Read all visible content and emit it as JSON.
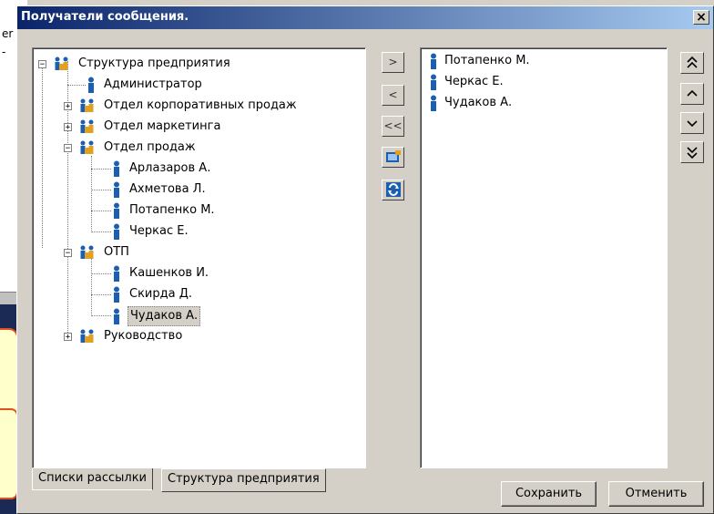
{
  "background": {
    "text_lines": [
      "er",
      "-"
    ]
  },
  "dialog": {
    "title": "Получатели сообщения.",
    "close_glyph": "×"
  },
  "tree": {
    "root": "Структура предприятия",
    "items": [
      {
        "label": "Структура предприятия",
        "type": "group",
        "level": 0,
        "expander": "−"
      },
      {
        "label": "Администратор",
        "type": "person",
        "level": 1,
        "expander": ""
      },
      {
        "label": "Отдел корпоративных продаж",
        "type": "group",
        "level": 1,
        "expander": "+"
      },
      {
        "label": "Отдел маркетинга",
        "type": "group",
        "level": 1,
        "expander": "+"
      },
      {
        "label": "Отдел продаж",
        "type": "group",
        "level": 1,
        "expander": "−"
      },
      {
        "label": "Арлазаров А.",
        "type": "person",
        "level": 2,
        "expander": ""
      },
      {
        "label": "Ахметова Л.",
        "type": "person",
        "level": 2,
        "expander": ""
      },
      {
        "label": "Потапенко М.",
        "type": "person",
        "level": 2,
        "expander": ""
      },
      {
        "label": "Черкас Е.",
        "type": "person",
        "level": 2,
        "expander": ""
      },
      {
        "label": "ОТП",
        "type": "group",
        "level": 1,
        "expander": "−"
      },
      {
        "label": "Кашенков И.",
        "type": "person",
        "level": 2,
        "expander": ""
      },
      {
        "label": "Скирда Д.",
        "type": "person",
        "level": 2,
        "expander": ""
      },
      {
        "label": "Чудаков А.",
        "type": "person",
        "level": 2,
        "expander": "",
        "selected": true
      },
      {
        "label": "Руководство",
        "type": "group",
        "level": 1,
        "expander": "+"
      }
    ]
  },
  "middle_buttons": {
    "add": ">",
    "remove": "<",
    "remove_all": "<<",
    "address_book_icon": "address-book-icon",
    "refresh_icon": "refresh-icon"
  },
  "recipients": {
    "items": [
      "Потапенко М.",
      "Черкас Е.",
      "Чудаков А."
    ]
  },
  "order_buttons": {
    "top": "⌃⌃",
    "up": "⌃",
    "down": "⌄",
    "bottom": "⌄⌄"
  },
  "tabs": {
    "mailing_lists": "Списки рассылки",
    "structure": "Структура предприятия"
  },
  "actions": {
    "save": "Сохранить",
    "cancel": "Отменить"
  },
  "colors": {
    "title_start": "#0a246a",
    "title_end": "#a6caf0",
    "window_bg": "#d4d0c8",
    "person_icon": "#1b5fb4",
    "group_icon": "#e0a020"
  }
}
